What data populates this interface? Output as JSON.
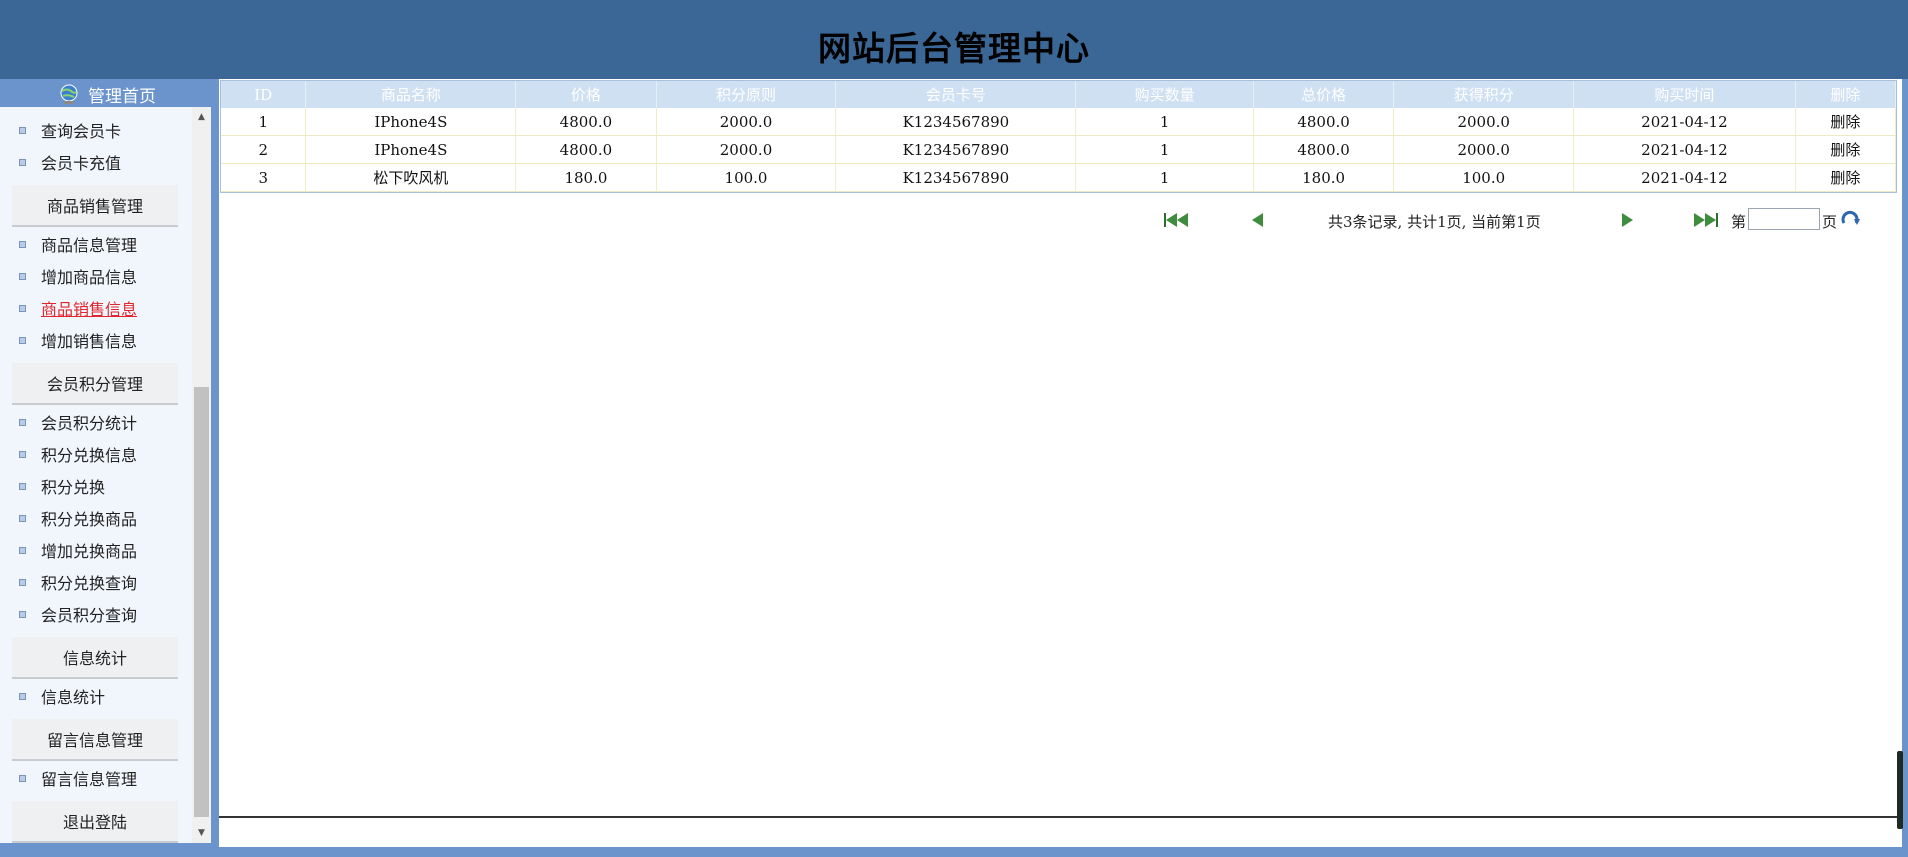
{
  "header": {
    "title": "网站后台管理中心"
  },
  "sidebar": {
    "home_label": "管理首页",
    "items": [
      {
        "label": "查询会员卡",
        "type": "item",
        "active": false
      },
      {
        "label": "会员卡充值",
        "type": "item",
        "active": false
      },
      {
        "label": "商品销售管理",
        "type": "section"
      },
      {
        "label": "商品信息管理",
        "type": "item",
        "active": false
      },
      {
        "label": "增加商品信息",
        "type": "item",
        "active": false
      },
      {
        "label": "商品销售信息",
        "type": "item",
        "active": true
      },
      {
        "label": "增加销售信息",
        "type": "item",
        "active": false
      },
      {
        "label": "会员积分管理",
        "type": "section"
      },
      {
        "label": "会员积分统计",
        "type": "item",
        "active": false
      },
      {
        "label": "积分兑换信息",
        "type": "item",
        "active": false
      },
      {
        "label": "积分兑换",
        "type": "item",
        "active": false
      },
      {
        "label": "积分兑换商品",
        "type": "item",
        "active": false
      },
      {
        "label": "增加兑换商品",
        "type": "item",
        "active": false
      },
      {
        "label": "积分兑换查询",
        "type": "item",
        "active": false
      },
      {
        "label": "会员积分查询",
        "type": "item",
        "active": false
      },
      {
        "label": "信息统计",
        "type": "section"
      },
      {
        "label": "信息统计",
        "type": "item",
        "active": false
      },
      {
        "label": "留言信息管理",
        "type": "section"
      },
      {
        "label": "留言信息管理",
        "type": "item",
        "active": false
      },
      {
        "label": "退出登陆",
        "type": "section"
      }
    ]
  },
  "table": {
    "columns": [
      "ID",
      "商品名称",
      "价格",
      "积分原则",
      "会员卡号",
      "购买数量",
      "总价格",
      "获得积分",
      "购买时间",
      "删除"
    ],
    "rows": [
      [
        "1",
        "IPhone4S",
        "4800.0",
        "2000.0",
        "K1234567890",
        "1",
        "4800.0",
        "2000.0",
        "2021-04-12",
        "删除"
      ],
      [
        "2",
        "IPhone4S",
        "4800.0",
        "2000.0",
        "K1234567890",
        "1",
        "4800.0",
        "2000.0",
        "2021-04-12",
        "删除"
      ],
      [
        "3",
        "松下吹风机",
        "180.0",
        "100.0",
        "K1234567890",
        "1",
        "180.0",
        "100.0",
        "2021-04-12",
        "删除"
      ]
    ]
  },
  "pager": {
    "summary": "共3条记录, 共计1页, 当前第1页",
    "prefix": "第",
    "suffix": "页",
    "page_value": ""
  },
  "colors": {
    "header_bg": "#3b6796",
    "frame_bg": "#6b94cc",
    "active_link": "#e0262c",
    "table_header_bg": "#cfe0f3"
  },
  "icons": [
    "globe-icon",
    "first-page-icon",
    "prev-page-icon",
    "next-page-icon",
    "last-page-icon",
    "refresh-icon"
  ]
}
